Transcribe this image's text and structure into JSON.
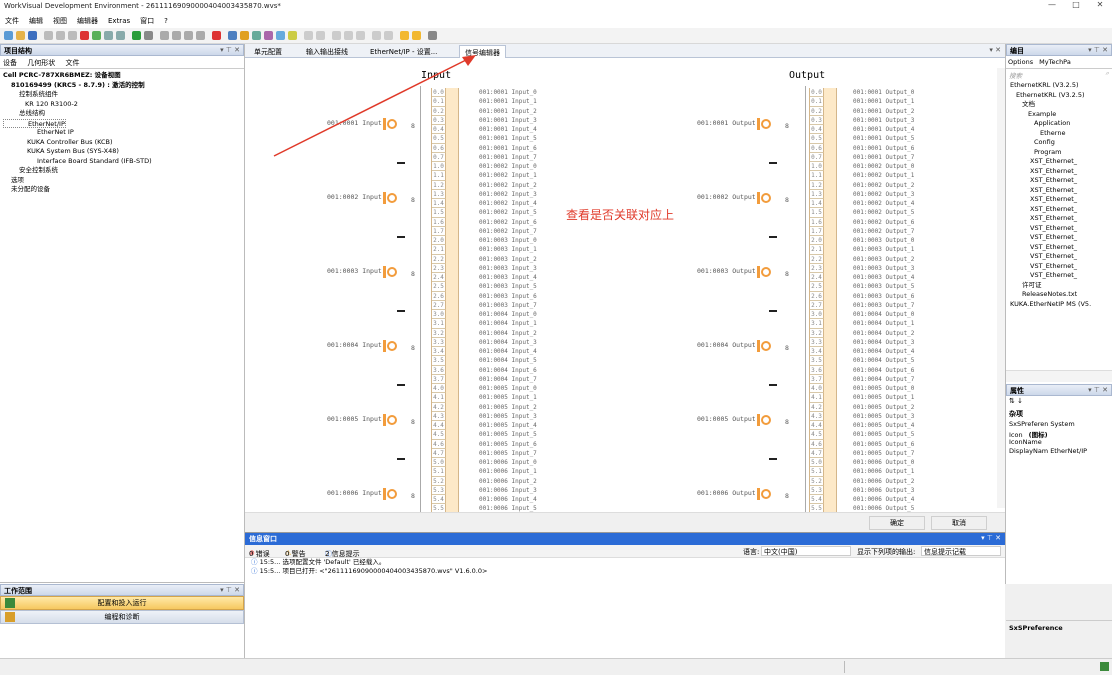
{
  "window": {
    "title": "WorkVisual Development Environment - 26111169090000404003435870.wvs*",
    "minimize": "—",
    "maximize": "□",
    "close": "✕"
  },
  "menu": [
    "文件",
    "编辑",
    "视图",
    "编辑器",
    "Extras",
    "窗口",
    "?"
  ],
  "left": {
    "title": "项目结构",
    "tabs": [
      "设备",
      "几何形状",
      "文件"
    ],
    "tree": [
      "Cell PCRC-787XR6BMEZ: 设备视图",
      "810169499 (KRC5 - 8.7.9) : 激活的控制",
      "控制系统组件",
      "KR 120 R3100-2",
      "总线结构",
      "EtherNet/IP",
      "EtherNet IP",
      "KUKA Controller Bus (KCB)",
      "KUKA System Bus (SYS-X48)",
      "Interface Board Standard (IFB-STD)",
      "安全控制系统",
      "选项",
      "未分配的设备"
    ]
  },
  "workscope": {
    "title": "工作范围",
    "items": [
      "配置和投入运行",
      "编程和诊断"
    ]
  },
  "center": {
    "tabs": [
      "单元配置",
      "输入输出接线",
      "EtherNet/IP - 设置...",
      "信号编辑器"
    ],
    "input_header": "Input",
    "output_header": "Output",
    "annotation": "查看是否关联对应上",
    "input_groups": [
      "001:0001 Input",
      "001:0002 Input",
      "001:0003 Input",
      "001:0004 Input",
      "001:0005 Input",
      "001:0006 Input"
    ],
    "output_groups": [
      "001:0001 Output",
      "001:0002 Output",
      "001:0003 Output",
      "001:0004 Output",
      "001:0005 Output",
      "001:0006 Output"
    ],
    "group_width": "8",
    "ok": "确定",
    "cancel": "取消"
  },
  "right": {
    "title": "编目",
    "tabs": [
      "Options",
      "MyTechPa"
    ],
    "search": "搜索",
    "tree": [
      "EthernetKRL (V3.2.5)",
      "EthernetKRL (V3.2.5)",
      "文档",
      "Example",
      "Application",
      "Etherne",
      "Config",
      "Program",
      "XST_Ethernet_",
      "XST_Ethernet_",
      "XST_Ethernet_",
      "XST_Ethernet_",
      "XST_Ethernet_",
      "XST_Ethernet_",
      "XST_Ethernet_",
      "VST_Ethernet_",
      "VST_Ethernet_",
      "VST_Ethernet_",
      "VST_Ethernet_",
      "VST_Ethernet_",
      "VST_Ethernet_",
      "许可证",
      "ReleaseNotes.txt",
      "KUKA.EtherNetIP MS (V5."
    ],
    "props_title": "属性",
    "props_group": "杂项",
    "props": [
      [
        "SxSPreferen System",
        ""
      ],
      [
        "Icon",
        "(图标)"
      ],
      [
        "IconName",
        ""
      ],
      [
        "DisplayNam EtherNet/IP",
        ""
      ]
    ],
    "props_footer": "SxSPreference"
  },
  "info": {
    "title": "信息窗口",
    "filters": [
      "0 错误",
      "0 警告",
      "2 信息提示"
    ],
    "lang_label": "语言:",
    "lang_value": "中文(中国)",
    "output_label": "显示下列项的输出:",
    "output_value": "信息提示记载",
    "messages": [
      "15:5...  选项配置文件 'Default' 已经载入。",
      "15:5...  项目已打开: <\"26111169090000404003435870.wvs\" V1.6.0.0>"
    ]
  }
}
